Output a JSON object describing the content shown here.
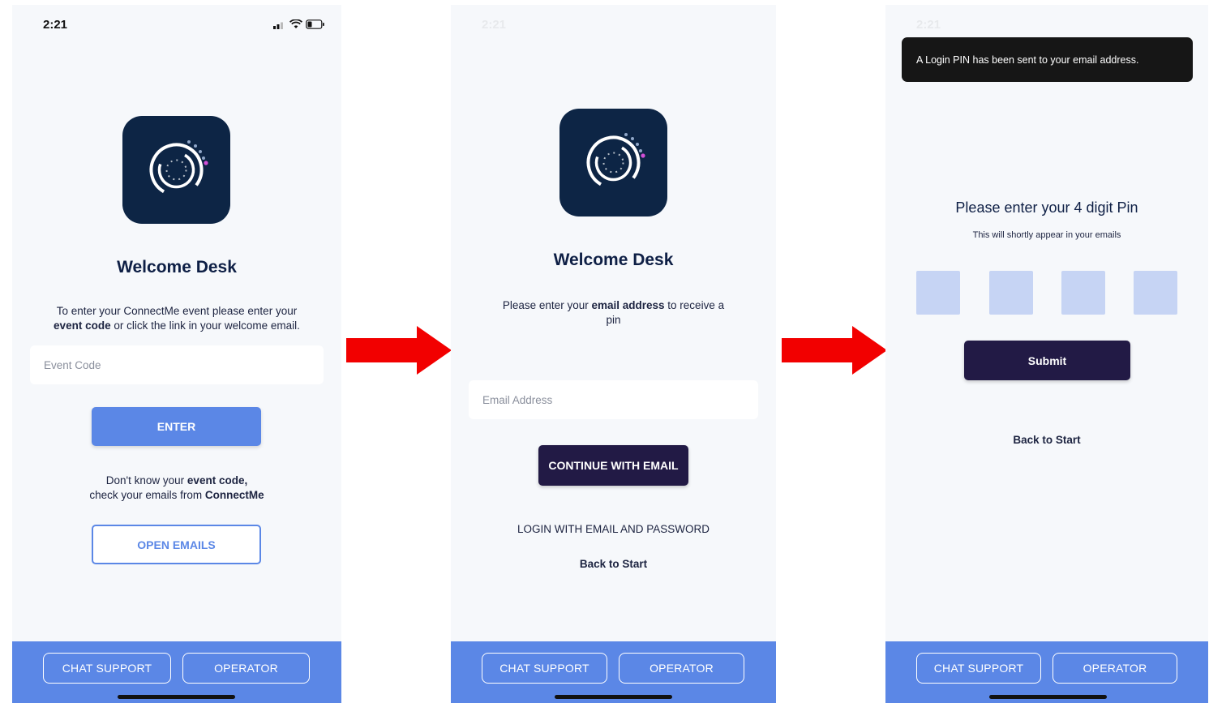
{
  "status": {
    "time": "2:21"
  },
  "brand": {
    "accent": "#5b87e6",
    "dark_button": "#221a45",
    "icon_bg": "#0d2545"
  },
  "screen1": {
    "title": "Welcome Desk",
    "instruction_pre": "To enter your ConnectMe event please enter your",
    "instruction_bold": "event code",
    "instruction_post": "or click the link in your welcome email.",
    "event_code_placeholder": "Event Code",
    "enter_label": "ENTER",
    "help_line1_pre": "Don't know your",
    "help_line1_bold": "event code,",
    "help_line2_pre": "check your emails from",
    "help_line2_bold": "ConnectMe",
    "open_emails_label": "OPEN EMAILS"
  },
  "screen2": {
    "title": "Welcome Desk",
    "instruction_pre": "Please enter your",
    "instruction_bold": "email address",
    "instruction_post": "to receive a pin",
    "email_placeholder": "Email Address",
    "continue_label": "CONTINUE WITH EMAIL",
    "login_password_label": "LOGIN WITH EMAIL AND PASSWORD",
    "back_label": "Back to Start"
  },
  "screen3": {
    "toast": "A Login PIN has been sent to your email address.",
    "pin_title": "Please enter your 4 digit Pin",
    "pin_subtitle": "This will shortly appear in your emails",
    "submit_label": "Submit",
    "back_label": "Back to Start"
  },
  "footer": {
    "chat_support_label": "CHAT SUPPORT",
    "operator_label": "OPERATOR"
  },
  "icons": [
    "app-logo-icon",
    "signal-icon",
    "wifi-icon",
    "battery-icon",
    "right-arrow-icon"
  ]
}
